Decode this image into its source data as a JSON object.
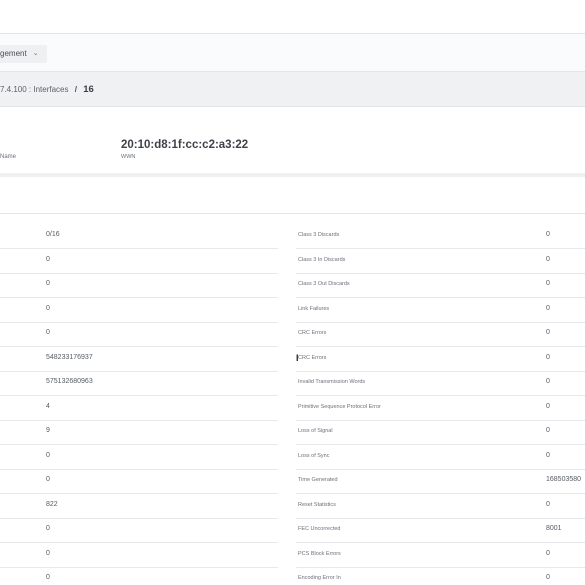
{
  "toolbar": {
    "management_label": "gement",
    "chevron_icon": "chevron-down-icon"
  },
  "breadcrumb": {
    "parent": "7.4.100 : Interfaces",
    "separator": "/",
    "current": "16"
  },
  "header": {
    "name_label": "Name",
    "wwn_value": "20:10:d8:1f:cc:c2:a3:22",
    "wwn_label": "WWN"
  },
  "left_values": [
    "0/16",
    "0",
    "0",
    "0",
    "0",
    "548233176937",
    "575132680963",
    "4",
    "9",
    "0",
    "0",
    "822",
    "0",
    "0",
    "0"
  ],
  "right_rows": [
    {
      "label": "Class 3 Discards",
      "value": "0"
    },
    {
      "label": "Class 3 In Discards",
      "value": "0"
    },
    {
      "label": "Class 3 Out Discards",
      "value": "0"
    },
    {
      "label": "Link Failures",
      "value": "0"
    },
    {
      "label": "CRC Errors",
      "value": "0"
    },
    {
      "label": "CRC Errors",
      "value": "0"
    },
    {
      "label": "Invalid Transmission Words",
      "value": "0"
    },
    {
      "label": "Primitive Sequence Protocol Error",
      "value": "0"
    },
    {
      "label": "Loss of Signal",
      "value": "0"
    },
    {
      "label": "Loss of Sync",
      "value": "0"
    },
    {
      "label": "Time Generated",
      "value": "168503580"
    },
    {
      "label": "Reset Statistics",
      "value": "0"
    },
    {
      "label": "FEC Uncorrected",
      "value": "8001"
    },
    {
      "label": "PCS Block Errors",
      "value": "0"
    },
    {
      "label": "Encoding Error In",
      "value": "0"
    }
  ]
}
